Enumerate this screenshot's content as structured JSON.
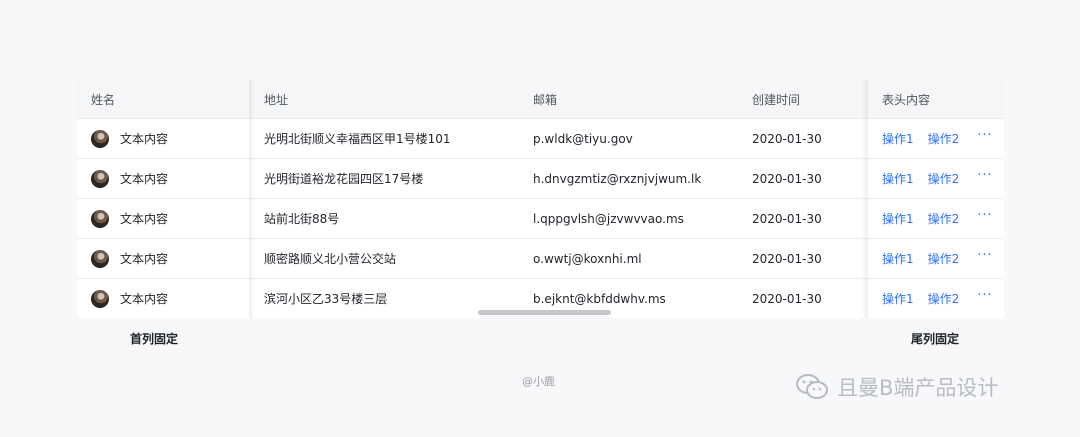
{
  "table": {
    "columns": {
      "name": "姓名",
      "address": "地址",
      "email": "邮箱",
      "created": "创建时间",
      "header_content": "表头内容"
    },
    "rows": [
      {
        "name": "文本内容",
        "address": "光明北街顺义幸福西区甲1号楼101",
        "email": "p.wldk@tiyu.gov",
        "created": "2020-01-30",
        "action1": "操作1",
        "action2": "操作2",
        "more": "···"
      },
      {
        "name": "文本内容",
        "address": "光明街道裕龙花园四区17号楼",
        "email": "h.dnvgzmtiz@rxznjvjwum.lk",
        "created": "2020-01-30",
        "action1": "操作1",
        "action2": "操作2",
        "more": "···"
      },
      {
        "name": "文本内容",
        "address": "站前北街88号",
        "email": "l.qppgvlsh@jzvwvvao.ms",
        "created": "2020-01-30",
        "action1": "操作1",
        "action2": "操作2",
        "more": "···"
      },
      {
        "name": "文本内容",
        "address": "顺密路顺义北小营公交站",
        "email": "o.wwtj@koxnhi.ml",
        "created": "2020-01-30",
        "action1": "操作1",
        "action2": "操作2",
        "more": "···"
      },
      {
        "name": "文本内容",
        "address": "滨河小区乙33号楼三层",
        "email": "b.ejknt@kbfddwhv.ms",
        "created": "2020-01-30",
        "action1": "操作1",
        "action2": "操作2",
        "more": "···"
      }
    ]
  },
  "captions": {
    "first_column_fixed": "首列固定",
    "last_column_fixed": "尾列固定"
  },
  "credit": "@小鹿",
  "watermark": "且曼B端产品设计",
  "colors": {
    "accent": "#3370ff",
    "header_bg": "#f5f6f7",
    "page_bg": "#f7f8fa"
  },
  "icons": {
    "avatar": "user-avatar",
    "more": "more-horizontal-icon",
    "watermark": "wechat-icon"
  }
}
